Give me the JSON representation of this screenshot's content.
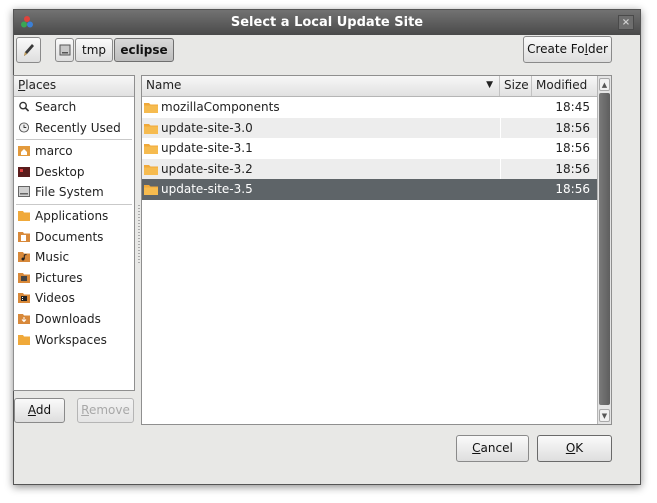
{
  "window": {
    "title": "Select a Local Update Site",
    "close_glyph": "×"
  },
  "toolbar": {
    "toggle_icon": "pencil-icon",
    "path": [
      "tmp",
      "eclipse"
    ],
    "create_folder_pre": "Create Fo",
    "create_folder_mn": "l",
    "create_folder_post": "der"
  },
  "places": {
    "header_mn": "P",
    "header_rest": "laces",
    "group1": [
      {
        "label": "Search",
        "icon": "search-icon"
      },
      {
        "label": "Recently Used",
        "icon": "clock-icon"
      }
    ],
    "group2": [
      {
        "label": "marco",
        "icon": "home-folder-icon"
      },
      {
        "label": "Desktop",
        "icon": "desktop-icon"
      },
      {
        "label": "File System",
        "icon": "drive-icon"
      }
    ],
    "group3": [
      {
        "label": "Applications",
        "icon": "folder-icon"
      },
      {
        "label": "Documents",
        "icon": "documents-folder-icon"
      },
      {
        "label": "Music",
        "icon": "music-folder-icon"
      },
      {
        "label": "Pictures",
        "icon": "pictures-folder-icon"
      },
      {
        "label": "Videos",
        "icon": "videos-folder-icon"
      },
      {
        "label": "Downloads",
        "icon": "downloads-folder-icon"
      },
      {
        "label": "Workspaces",
        "icon": "folder-icon"
      }
    ],
    "add_mn": "A",
    "add_rest": "dd",
    "remove_mn": "R",
    "remove_rest": "emove"
  },
  "files": {
    "columns": {
      "name": "Name",
      "size": "Size",
      "modified": "Modified"
    },
    "rows": [
      {
        "name": "mozillaComponents",
        "modified": "18:45"
      },
      {
        "name": "update-site-3.0",
        "modified": "18:56"
      },
      {
        "name": "update-site-3.1",
        "modified": "18:56"
      },
      {
        "name": "update-site-3.2",
        "modified": "18:56"
      },
      {
        "name": "update-site-3.5",
        "modified": "18:56"
      }
    ],
    "selected_index": 4
  },
  "buttons": {
    "cancel_mn": "C",
    "cancel_rest": "ancel",
    "ok_mn": "O",
    "ok_rest": "K"
  },
  "colors": {
    "titlebar": "#4a4a4a",
    "selection": "#5e6468",
    "folder": "#f0a93a"
  }
}
